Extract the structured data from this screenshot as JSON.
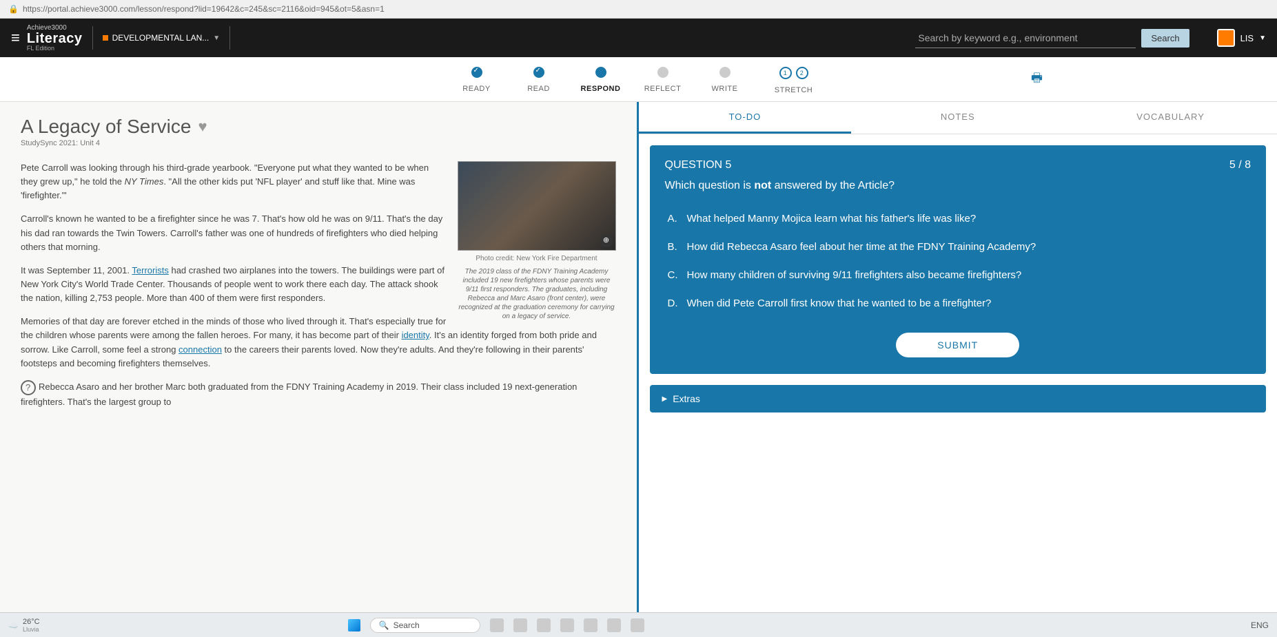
{
  "url": "https://portal.achieve3000.com/lesson/respond?lid=19642&c=245&sc=2116&oid=945&ot=5&asn=1",
  "brand": {
    "top": "Achieve3000",
    "main": "Literacy",
    "edition": "FL Edition"
  },
  "course_dropdown": "DEVELOPMENTAL LAN...",
  "search": {
    "placeholder": "Search by keyword e.g., environment",
    "button": "Search"
  },
  "user": {
    "name": "LIS"
  },
  "steps": [
    {
      "label": "READY",
      "state": "done"
    },
    {
      "label": "READ",
      "state": "done"
    },
    {
      "label": "RESPOND",
      "state": "active"
    },
    {
      "label": "REFLECT",
      "state": ""
    },
    {
      "label": "WRITE",
      "state": ""
    },
    {
      "label": "STRETCH",
      "state": "stretch",
      "sub": [
        "1",
        "2"
      ]
    }
  ],
  "article": {
    "title": "A Legacy of Service",
    "subtitle": "StudySync 2021: Unit 4",
    "figure": {
      "credit": "Photo credit: New York Fire Department",
      "caption": "The 2019 class of the FDNY Training Academy included 19 new firefighters whose parents were 9/11 first responders. The graduates, including Rebecca and Marc Asaro (front center), were recognized at the graduation ceremony for carrying on a legacy of service."
    },
    "p1a": "Pete Carroll was looking through his third-grade yearbook. \"Everyone put what they wanted to be when they grew up,\" he told the ",
    "p1_em": "NY Times",
    "p1b": ". \"All the other kids put 'NFL player' and stuff like that. Mine was 'firefighter.'\"",
    "p2": "Carroll's known he wanted to be a firefighter since he was 7. That's how old he was on 9/11. That's the day his dad ran towards the Twin Towers. Carroll's father was one of hundreds of firefighters who died helping others that morning.",
    "p3a": "It was September 11, 2001. ",
    "p3_link": "Terrorists",
    "p3b": " had crashed two airplanes into the towers. The buildings were part of New York City's World Trade Center. Thousands of people went to work there each day. The attack shook the nation, killing 2,753 people. More than 400 of them were first responders.",
    "p4a": "Memories of that day are forever etched in the minds of those who lived through it. That's especially true for the children whose parents were among the fallen heroes. For many, it has become part of their ",
    "p4_link1": "identity",
    "p4b": ". It's an identity forged from both pride and sorrow. Like Carroll, some feel a strong ",
    "p4_link2": "connection",
    "p4c": " to the careers their parents loved. Now they're adults. And they're following in their parents' footsteps and becoming firefighters themselves.",
    "p5": "Rebecca Asaro and her brother Marc both graduated from the FDNY Training Academy in 2019. Their class included 19 next-generation firefighters. That's the largest group to"
  },
  "tabs": {
    "todo": "TO-DO",
    "notes": "NOTES",
    "vocab": "VOCABULARY"
  },
  "question": {
    "label": "QUESTION 5",
    "progress": "5 / 8",
    "prompt_a": "Which question is ",
    "prompt_b": "not",
    "prompt_c": " answered by the Article?",
    "choices": [
      {
        "letter": "A.",
        "text": "What helped Manny Mojica learn what his father's life was like?"
      },
      {
        "letter": "B.",
        "text": "How did Rebecca Asaro feel about her time at the FDNY Training Academy?"
      },
      {
        "letter": "C.",
        "text": "How many children of surviving 9/11 firefighters also became firefighters?"
      },
      {
        "letter": "D.",
        "text": "When did Pete Carroll first know that he wanted to be a firefighter?"
      }
    ],
    "submit": "SUBMIT"
  },
  "extras": "Extras",
  "taskbar": {
    "temp": "26°C",
    "cond": "Lluvia",
    "search": "Search",
    "lang": "ENG"
  }
}
